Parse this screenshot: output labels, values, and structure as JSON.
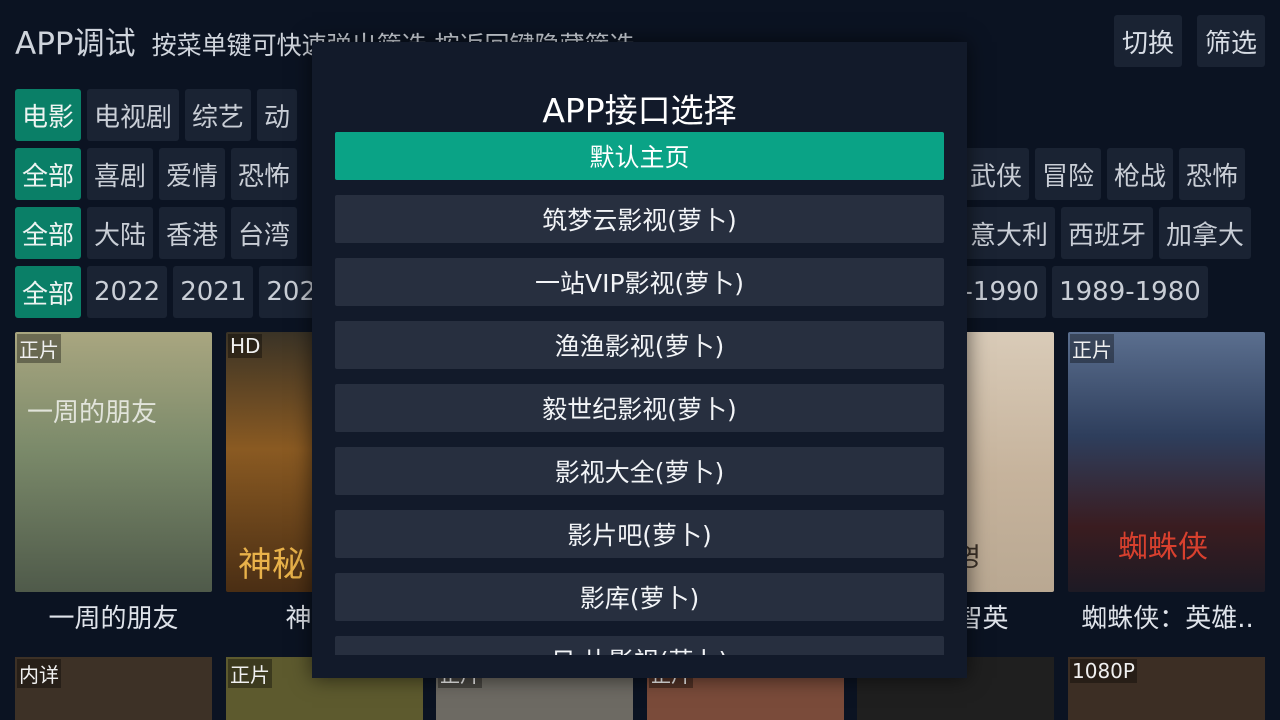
{
  "header": {
    "app_title": "APP调试",
    "hint": "按菜单键可快速弹出筛选 按返回键隐藏筛选",
    "switch_label": "切换",
    "filter_label": "筛选"
  },
  "filters": {
    "category": [
      "电影",
      "电视剧",
      "综艺",
      "动"
    ],
    "genre_left": [
      "全部",
      "喜剧",
      "爱情",
      "恐怖"
    ],
    "genre_right": [
      "武侠",
      "冒险",
      "枪战",
      "恐怖"
    ],
    "region_left": [
      "全部",
      "大陆",
      "香港",
      "台湾"
    ],
    "region_right": [
      "意大利",
      "西班牙",
      "加拿大"
    ],
    "year_left": [
      "全部",
      "2022",
      "2021",
      "202"
    ],
    "year_right": [
      "9-1990",
      "1989-1980"
    ]
  },
  "posters": [
    {
      "badge": "正片",
      "title": "一周的朋友",
      "overlay": "一周的朋友",
      "color": "#8a8d6a"
    },
    {
      "badge": "HD",
      "title": "神秘海",
      "overlay": "神秘",
      "color": "#6b4a22"
    },
    {
      "badge": "",
      "title": "动金智英",
      "overlay": "영",
      "color": "#c9b9a6"
    },
    {
      "badge": "正片",
      "title": "蜘蛛侠：英雄..",
      "overlay": "蜘蛛侠",
      "color": "#2a3a5a"
    }
  ],
  "bottom_posters": [
    {
      "badge": "内详",
      "color": "#3d3126"
    },
    {
      "badge": "正片",
      "color": "#5d5a2e"
    },
    {
      "badge": "正片",
      "color": "#6d6a63"
    },
    {
      "badge": "正片",
      "color": "#7a4b3a"
    },
    {
      "badge": "",
      "color": "#1f1f1f"
    },
    {
      "badge": "1080P",
      "color": "#3c2e24"
    }
  ],
  "dialog": {
    "title": "APP接口选择",
    "options": [
      "默认主页",
      "筑梦云影视(萝卜)",
      "一站VIP影视(萝卜)",
      "渔渔影视(萝卜)",
      "毅世纪影视(萝卜)",
      "影视大全(萝卜)",
      "影片吧(萝卜)",
      "影库(萝卜)",
      "日 片影视(萝卜)"
    ],
    "selected_index": 0
  },
  "colors": {
    "background": "#0b1322",
    "accent": "#0a7f67",
    "selected_option": "#0aa386",
    "option_bg": "#272f3f",
    "dialog_bg": "#121a2a"
  }
}
